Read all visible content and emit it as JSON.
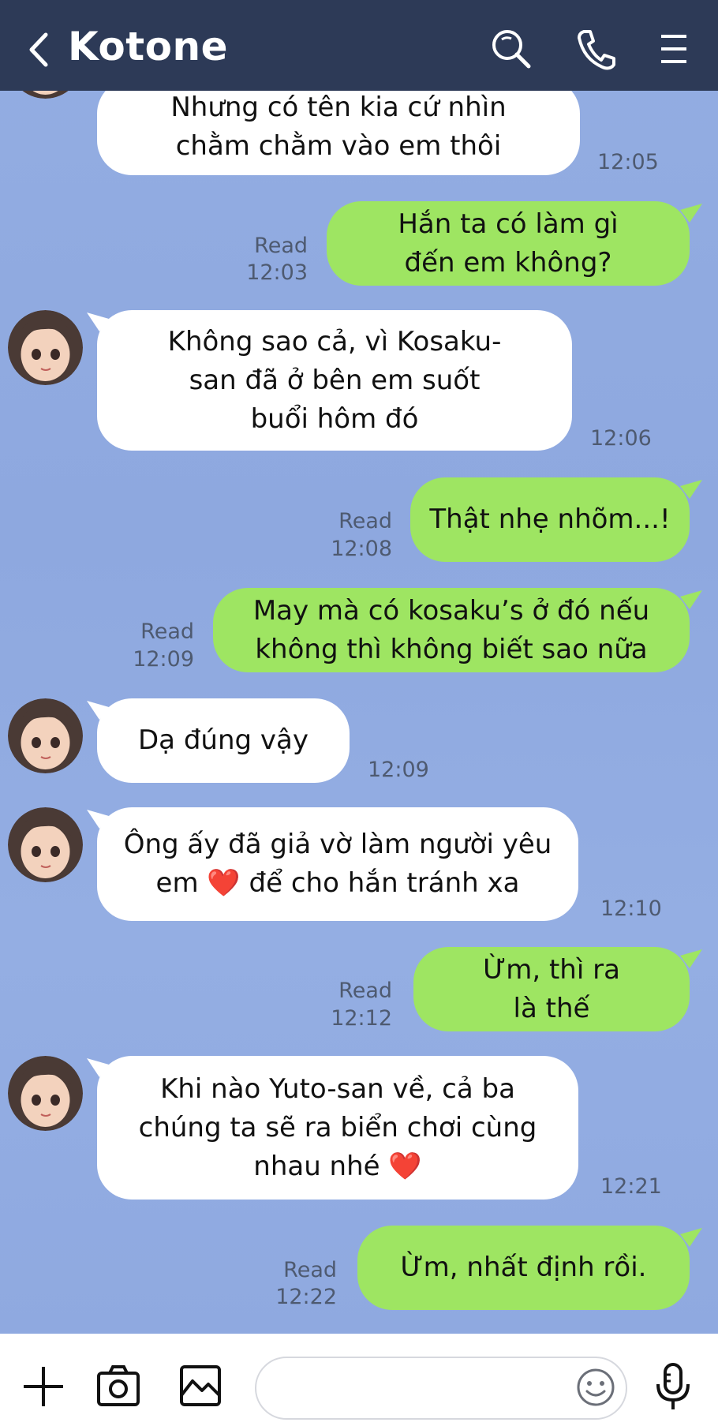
{
  "header": {
    "title": "Kotone"
  },
  "messages": [
    {
      "side": "in",
      "text": "Nhưng có tên kia cứ nhìn\nchằm chằm vào em thôi",
      "time": "12:05"
    },
    {
      "side": "out",
      "text": "Hắn ta có làm gì\nđến em không?",
      "read": "Read",
      "time": "12:03"
    },
    {
      "side": "in",
      "text": "Không sao cả, vì Kosaku-\nsan đã ở bên em suốt\nbuổi hôm đó",
      "time": "12:06"
    },
    {
      "side": "out",
      "text": "Thật nhẹ nhõm...!",
      "read": "Read",
      "time": "12:08"
    },
    {
      "side": "out",
      "text": "May mà có kosaku’s ở đó nếu\nkhông thì không biết sao nữa",
      "read": "Read",
      "time": "12:09"
    },
    {
      "side": "in",
      "text": "Dạ đúng vậy",
      "time": "12:09"
    },
    {
      "side": "in",
      "text": "Ông ấy đã giả vờ làm người yêu\nem ❤️ để cho hắn tránh xa",
      "time": "12:10"
    },
    {
      "side": "out",
      "text": "Ừm, thì ra\nlà thế",
      "read": "Read",
      "time": "12:12"
    },
    {
      "side": "in",
      "text": "Khi nào Yuto-san về, cả ba\nchúng ta sẽ ra biển chơi cùng\nnhau nhé ❤️",
      "time": "12:21"
    },
    {
      "side": "out",
      "text": "Ừm, nhất định rồi.",
      "read": "Read",
      "time": "12:22"
    }
  ],
  "input": {
    "placeholder": ""
  },
  "colors": {
    "header": "#2d3a57",
    "background": "#8fa9e0",
    "outgoing": "#9ee562",
    "incoming": "#ffffff"
  },
  "icons": [
    "back-icon",
    "search-icon",
    "phone-icon",
    "menu-icon",
    "plus-icon",
    "camera-icon",
    "image-icon",
    "emoji-icon",
    "mic-icon"
  ]
}
